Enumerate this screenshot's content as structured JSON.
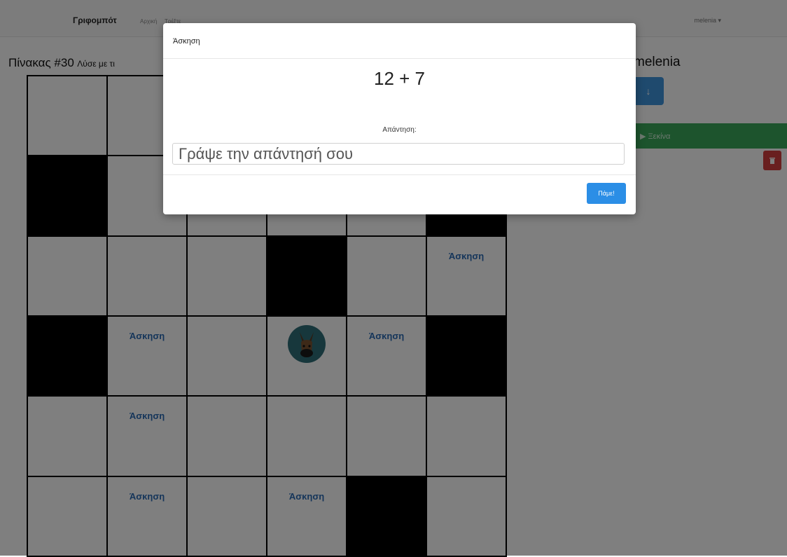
{
  "navbar": {
    "brand": "Γριφομπότ",
    "links": [
      "Αρχική",
      "Τρέξτε"
    ],
    "user_menu": "melenia ▾"
  },
  "board": {
    "title": "Πίνακας #30",
    "subtitle": "Λύσε με τι",
    "grid": [
      [
        "white",
        "white",
        "white",
        "white",
        "white",
        "white"
      ],
      [
        "black",
        "white",
        "white",
        "white",
        "white",
        "black"
      ],
      [
        "white",
        "white",
        "white",
        "black",
        "white",
        "exercise"
      ],
      [
        "black",
        "exercise",
        "white",
        "avatar",
        "exercise",
        "black"
      ],
      [
        "white",
        "exercise",
        "white",
        "white",
        "white",
        "white"
      ],
      [
        "white",
        "exercise",
        "white",
        "exercise",
        "black",
        "white"
      ]
    ],
    "exercise_label": "Άσκηση"
  },
  "sidebar": {
    "username": "melenia",
    "arrow_icon": "↓",
    "start_label": "▶ Ξεκίνα",
    "delete_icon": "trash-icon",
    "colors": {
      "arrow": "#3f95dd",
      "start": "#3aa95a",
      "delete": "#d23f3f"
    }
  },
  "modal": {
    "title": "Άσκηση",
    "equation": "12 + 7",
    "answer_label": "Απάντηση:",
    "answer_placeholder": "Γράψε την απάντησή σου",
    "answer_value": "",
    "submit_label": "Πάμε!",
    "accent": "#2b8ee6"
  }
}
